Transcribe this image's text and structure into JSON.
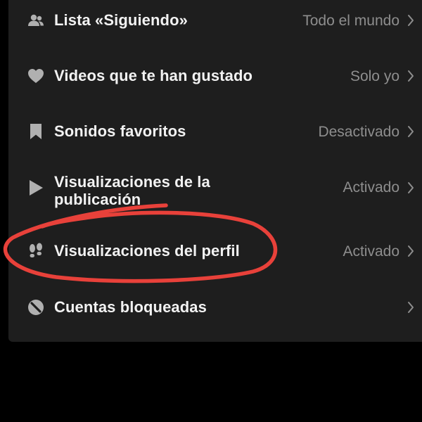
{
  "settings": {
    "items": [
      {
        "icon": "people-icon",
        "label": "Lista «Siguiendo»",
        "value": "Todo el mundo"
      },
      {
        "icon": "heart-icon",
        "label": "Videos que te han gustado",
        "value": "Solo yo"
      },
      {
        "icon": "bookmark-icon",
        "label": "Sonidos favoritos",
        "value": "Desactivado"
      },
      {
        "icon": "play-icon",
        "label": "Visualizaciones de la publicación",
        "value": "Activado"
      },
      {
        "icon": "footprints-icon",
        "label": "Visualizaciones del perfil",
        "value": "Activado"
      },
      {
        "icon": "block-icon",
        "label": "Cuentas bloqueadas",
        "value": ""
      }
    ]
  },
  "colors": {
    "background": "#000000",
    "panel": "#1e1e1e",
    "label": "#f2f2f2",
    "value": "#8e8e8e",
    "icon": "#b0b0b0",
    "highlight": "#e8413a"
  }
}
